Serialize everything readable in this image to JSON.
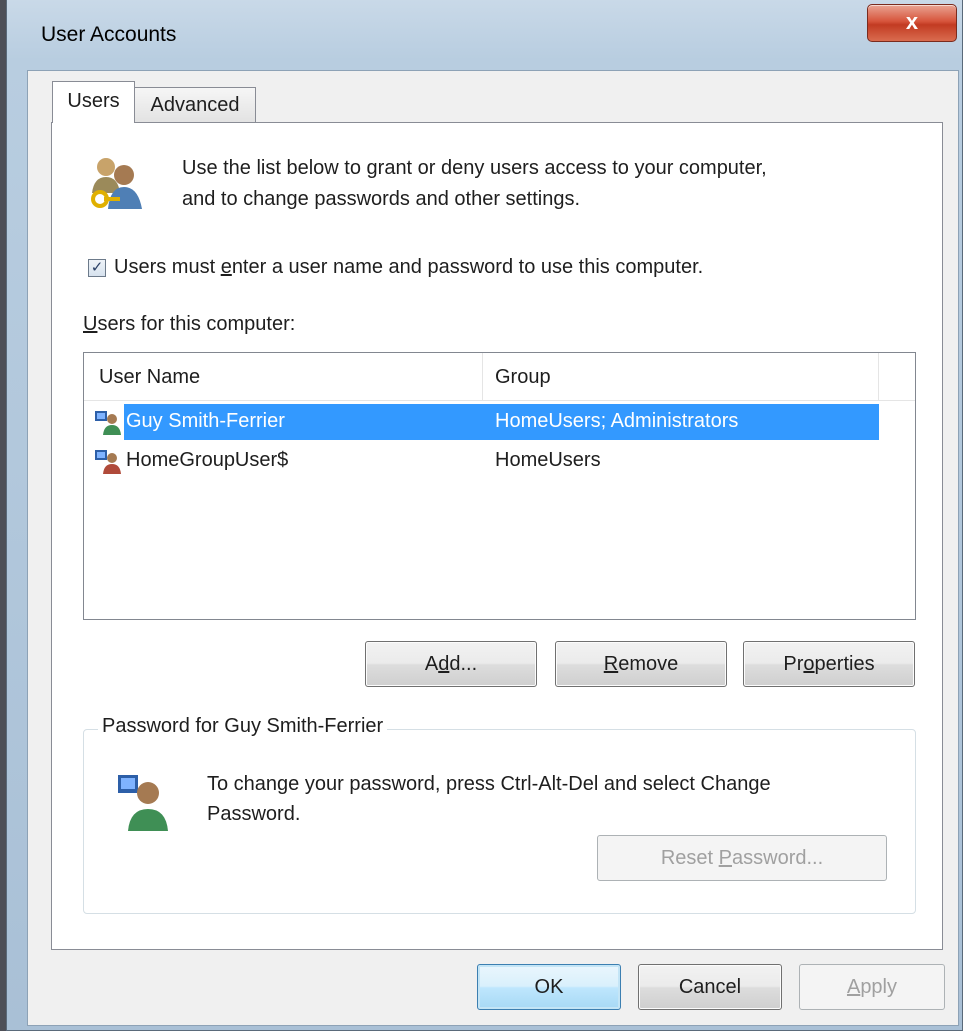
{
  "window": {
    "title": "User Accounts",
    "close_glyph": "x"
  },
  "tabs": [
    {
      "label": "Users",
      "active": true
    },
    {
      "label": "Advanced",
      "active": false
    }
  ],
  "users_tab": {
    "intro_line1": "Use the list below to grant or deny users access to your computer,",
    "intro_line2": "and to change passwords and other settings.",
    "require_login": {
      "checked": true,
      "label_before": "Users must ",
      "label_accel": "e",
      "label_after": "nter a user name and password to use this computer."
    },
    "list_label_accel": "U",
    "list_label_rest": "sers for this computer:",
    "columns": [
      "User Name",
      "Group"
    ],
    "users": [
      {
        "name": "Guy Smith-Ferrier",
        "group": "HomeUsers; Administrators",
        "selected": true,
        "icon": "user-account-icon"
      },
      {
        "name": "HomeGroupUser$",
        "group": "HomeUsers",
        "selected": false,
        "icon": "user-account-icon"
      }
    ],
    "buttons": {
      "add": {
        "pre": "A",
        "accel": "d",
        "post": "d..."
      },
      "remove": {
        "pre": "",
        "accel": "R",
        "post": "emove"
      },
      "properties": {
        "pre": "Pr",
        "accel": "o",
        "post": "perties"
      }
    },
    "password_group": {
      "title": "Password for Guy Smith-Ferrier",
      "text_line1": "To change your password, press Ctrl-Alt-Del and select Change",
      "text_line2": "Password.",
      "reset_button": {
        "pre": "Reset ",
        "accel": "P",
        "post": "assword...",
        "enabled": false
      }
    }
  },
  "footer": {
    "ok": "OK",
    "cancel": "Cancel",
    "apply_accel": "A",
    "apply_rest": "pply",
    "apply_enabled": false
  },
  "colors": {
    "selection": "#3399ff",
    "close_button": "#c23b22"
  }
}
